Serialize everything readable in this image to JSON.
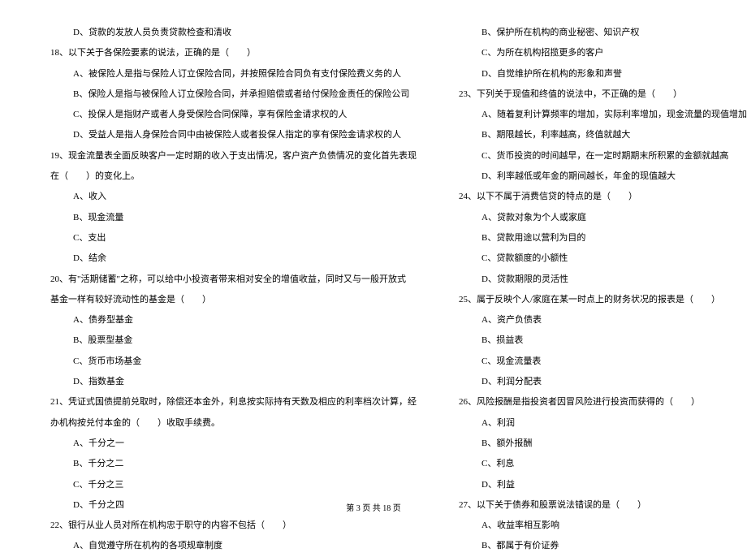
{
  "left": {
    "opt17d": "D、贷款的发放人员负责贷款检查和清收",
    "q18": "18、以下关于各保险要素的说法，正确的是（　　）",
    "q18a": "A、被保险人是指与保险人订立保险合同，并按照保险合同负有支付保险费义务的人",
    "q18b": "B、保险人是指与被保险人订立保险合同，并承担赔偿或者给付保险金责任的保险公司",
    "q18c": "C、投保人是指财产或者人身受保险合同保障，享有保险金请求权的人",
    "q18d": "D、受益人是指人身保险合同中由被保险人或者投保人指定的享有保险金请求权的人",
    "q19": "19、现金流量表全面反映客户一定时期的收入于支出情况，客户资产负债情况的变化首先表现",
    "q19cont": "在（　　）的变化上。",
    "q19a": "A、收入",
    "q19b": "B、现金流量",
    "q19c": "C、支出",
    "q19d": "D、结余",
    "q20": "20、有\"活期储蓄\"之称，可以给中小投资者带来相对安全的增值收益，同时又与一般开放式",
    "q20cont": "基金一样有较好流动性的基金是（　　）",
    "q20a": "A、债券型基金",
    "q20b": "B、股票型基金",
    "q20c": "C、货币市场基金",
    "q20d": "D、指数基金",
    "q21": "21、凭证式国债提前兑取时，除偿还本金外，利息按实际持有天数及相应的利率档次计算，经",
    "q21cont": "办机构按兑付本金的（　　）收取手续费。",
    "q21a": "A、千分之一",
    "q21b": "B、千分之二",
    "q21c": "C、千分之三",
    "q21d": "D、千分之四",
    "q22": "22、银行从业人员对所在机构忠于职守的内容不包括（　　）",
    "q22a": "A、自觉遵守所在机构的各项规章制度"
  },
  "right": {
    "q22b": "B、保护所在机构的商业秘密、知识产权",
    "q22c": "C、为所在机构招揽更多的客户",
    "q22d": "D、自觉维护所在机构的形象和声誉",
    "q23": "23、下列关于现值和终值的说法中，不正确的是（　　）",
    "q23a": "A、随着复利计算频率的增加，实际利率增加，现金流量的现值增加",
    "q23b": "B、期限越长，利率越高，终值就越大",
    "q23c": "C、货币投资的时间越早，在一定时期期末所积累的金额就越高",
    "q23d": "D、利率越低或年金的期间越长，年金的现值越大",
    "q24": "24、以下不属于消费信贷的特点的是（　　）",
    "q24a": "A、贷款对象为个人或家庭",
    "q24b": "B、贷款用途以营利为目的",
    "q24c": "C、贷款额度的小额性",
    "q24d": "D、贷款期限的灵活性",
    "q25": "25、属于反映个人/家庭在某一时点上的财务状况的报表是（　　）",
    "q25a": "A、资产负债表",
    "q25b": "B、损益表",
    "q25c": "C、现金流量表",
    "q25d": "D、利润分配表",
    "q26": "26、风险报酬是指投资者因冒风险进行投资而获得的（　　）",
    "q26a": "A、利润",
    "q26b": "B、额外报酬",
    "q26c": "C、利息",
    "q26d": "D、利益",
    "q27": "27、以下关于债券和股票说法错误的是（　　）",
    "q27a": "A、收益率相互影响",
    "q27b": "B、都属于有价证券"
  },
  "footer": "第 3 页 共 18 页"
}
